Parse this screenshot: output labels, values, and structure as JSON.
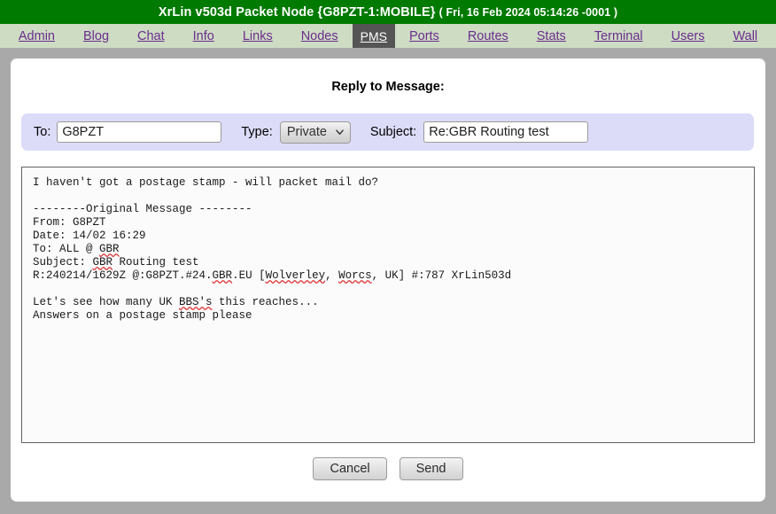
{
  "header": {
    "title_main": "XrLin v503d Packet Node {G8PZT-1:MOBILE}",
    "title_date": "( Fri, 16 Feb 2024 05:14:26 -0001 )"
  },
  "nav": {
    "items": [
      {
        "label": "Admin",
        "active": false
      },
      {
        "label": "Blog",
        "active": false
      },
      {
        "label": "Chat",
        "active": false
      },
      {
        "label": "Info",
        "active": false
      },
      {
        "label": "Links",
        "active": false
      },
      {
        "label": "Nodes",
        "active": false
      },
      {
        "label": "PMS",
        "active": true
      },
      {
        "label": "Ports",
        "active": false
      },
      {
        "label": "Routes",
        "active": false
      },
      {
        "label": "Stats",
        "active": false
      },
      {
        "label": "Terminal",
        "active": false
      },
      {
        "label": "Users",
        "active": false
      },
      {
        "label": "Wall",
        "active": false
      }
    ]
  },
  "page": {
    "heading": "Reply to Message:"
  },
  "form": {
    "to_label": "To:",
    "to_value": "G8PZT",
    "type_label": "Type:",
    "type_value": "Private",
    "type_options": [
      "Private"
    ],
    "subject_label": "Subject:",
    "subject_value": "Re:GBR Routing test",
    "chevron_icon": "chevron-down-icon"
  },
  "message_body": {
    "lines": [
      "I haven't got a postage stamp - will packet mail do?",
      "",
      "--------Original Message --------",
      "From: G8PZT",
      "Date: 14/02 16:29",
      "To: ALL @ GBR",
      "Subject: GBR Routing test",
      "R:240214/1629Z @:G8PZT.#24.GBR.EU [Wolverley, Worcs, UK] #:787 XrLin503d",
      "",
      "Let's see how many UK BBS's this reaches...",
      "Answers on a postage stamp please"
    ],
    "misspelled_words": [
      "GBR",
      "Wolverley",
      "Worcs",
      "BBS's"
    ]
  },
  "buttons": {
    "cancel_label": "Cancel",
    "send_label": "Send"
  },
  "colors": {
    "header_green": "#007a00",
    "nav_bar": "#cedcc4",
    "nav_link": "#6b2d8e",
    "active_tab": "#555555",
    "page_background": "#a9a9a9",
    "panel": "#ffffff",
    "form_band": "#dcdcf8",
    "spellcheck_underline": "#e03030"
  }
}
